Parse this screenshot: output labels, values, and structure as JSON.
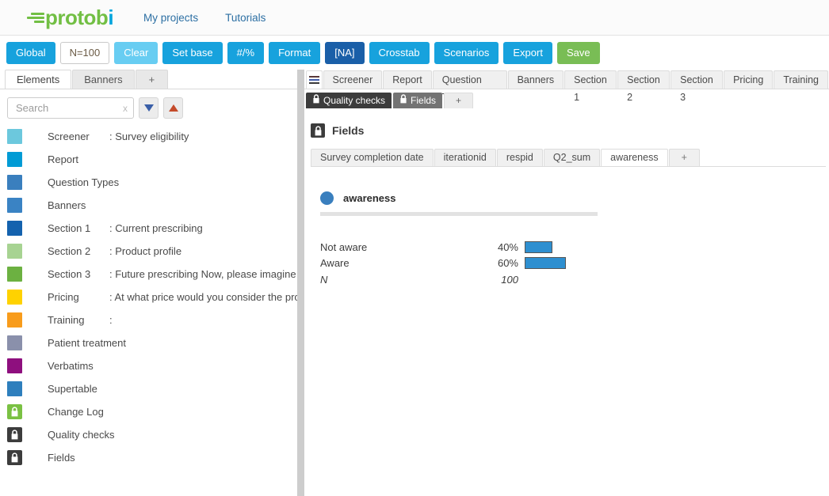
{
  "brand": {
    "logo_text_green": "protob",
    "logo_text_blue": "i",
    "accent_blue": "#17a2dd",
    "accent_green": "#79bd55",
    "navy": "#1a5fa8",
    "bar_blue": "#2e8fd0"
  },
  "topnav": {
    "links": [
      {
        "label": "My projects"
      },
      {
        "label": "Tutorials"
      }
    ]
  },
  "toolbar": {
    "buttons": [
      {
        "label": "Global",
        "style": "blue"
      },
      {
        "label": "N=100",
        "style": "white"
      },
      {
        "label": "Clear",
        "style": "lightblue"
      },
      {
        "label": "Set base",
        "style": "blue"
      },
      {
        "label": "#/%",
        "style": "blue"
      },
      {
        "label": "Format",
        "style": "blue"
      },
      {
        "label": "[NA]",
        "style": "navy"
      },
      {
        "label": "Crosstab",
        "style": "blue"
      },
      {
        "label": "Scenarios",
        "style": "blue"
      },
      {
        "label": "Export",
        "style": "blue"
      },
      {
        "label": "Save",
        "style": "green"
      }
    ]
  },
  "left_panel": {
    "tabs": [
      {
        "label": "Elements",
        "active": true
      },
      {
        "label": "Banners",
        "active": false
      },
      {
        "label": "+",
        "active": false
      }
    ],
    "search": {
      "placeholder": "Search",
      "value": "",
      "clear_label": "x",
      "sort_down_icon": "triangle-down-icon",
      "sort_up_icon": "triangle-up-icon"
    },
    "items": [
      {
        "label": "Screener",
        "desc": ": Survey eligibility",
        "color": "#6cc8dd",
        "icon": "swatch"
      },
      {
        "label": "Report",
        "desc": "",
        "color": "#009bd5",
        "icon": "swatch"
      },
      {
        "label": "Question Types",
        "desc": "",
        "color": "#3a7fbe",
        "icon": "swatch"
      },
      {
        "label": "Banners",
        "desc": "",
        "color": "#3a83c4",
        "icon": "swatch"
      },
      {
        "label": "Section 1",
        "desc": ": Current prescribing",
        "color": "#1462ae",
        "icon": "swatch"
      },
      {
        "label": "Section 2",
        "desc": ": Product profile",
        "color": "#a7d392",
        "icon": "swatch"
      },
      {
        "label": "Section 3",
        "desc": ": Future prescribing Now, please imagine tha",
        "color": "#6cb141",
        "icon": "swatch"
      },
      {
        "label": "Pricing",
        "desc": ": At what price would you consider the prod",
        "color": "#ffd200",
        "icon": "swatch"
      },
      {
        "label": "Training",
        "desc": ":",
        "color": "#f89c1c",
        "icon": "swatch"
      },
      {
        "label": "Patient treatment",
        "desc": "",
        "color": "#8a90ab",
        "icon": "swatch",
        "wide": true
      },
      {
        "label": "Verbatims",
        "desc": "",
        "color": "#8e0f7e",
        "icon": "swatch",
        "wide": true
      },
      {
        "label": "Supertable",
        "desc": "",
        "color": "#2e7fbd",
        "icon": "swatch",
        "wide": true
      },
      {
        "label": "Change Log",
        "desc": "",
        "color": "#7ac143",
        "icon": "lock-icon",
        "wide": true
      },
      {
        "label": "Quality checks",
        "desc": "",
        "color": "#3c3c3c",
        "icon": "lock-icon",
        "wide": true
      },
      {
        "label": "Fields",
        "desc": "",
        "color": "#3c3c3c",
        "icon": "lock-icon",
        "wide": true
      }
    ]
  },
  "right_panel": {
    "menu_icon": "hamburger-icon",
    "tabs": [
      {
        "label": "Screener"
      },
      {
        "label": "Report"
      },
      {
        "label": "Question Types"
      },
      {
        "label": "Banners"
      },
      {
        "label": "Section 1"
      },
      {
        "label": "Section 2"
      },
      {
        "label": "Section 3"
      },
      {
        "label": "Pricing"
      },
      {
        "label": "Training"
      }
    ],
    "subtabs": [
      {
        "label": "Quality checks",
        "style": "dark",
        "icon": "lock-icon"
      },
      {
        "label": "Fields",
        "style": "gray",
        "icon": "lock-icon"
      },
      {
        "label": "+",
        "style": "plus",
        "icon": ""
      }
    ],
    "panel_title": "Fields",
    "panel_title_icon": "lock-icon",
    "field_tabs": [
      {
        "label": "Survey completion date",
        "active": false
      },
      {
        "label": "iterationid",
        "active": false
      },
      {
        "label": "respid",
        "active": false
      },
      {
        "label": "Q2_sum",
        "active": false
      },
      {
        "label": "awareness",
        "active": true
      },
      {
        "label": "+",
        "active": false
      }
    ]
  },
  "chart_data": {
    "type": "bar",
    "title": "awareness",
    "orientation": "horizontal",
    "categories": [
      "Not aware",
      "Aware"
    ],
    "values": [
      40,
      60
    ],
    "value_labels": [
      "40%",
      "60%"
    ],
    "unit": "%",
    "xlabel": "",
    "ylabel": "",
    "xlim": [
      0,
      100
    ],
    "grid": false,
    "legend": false,
    "base_label": "N",
    "base_value": "100",
    "series_color": "#2e8fd0",
    "marker_icon": "blue-dot-icon"
  }
}
